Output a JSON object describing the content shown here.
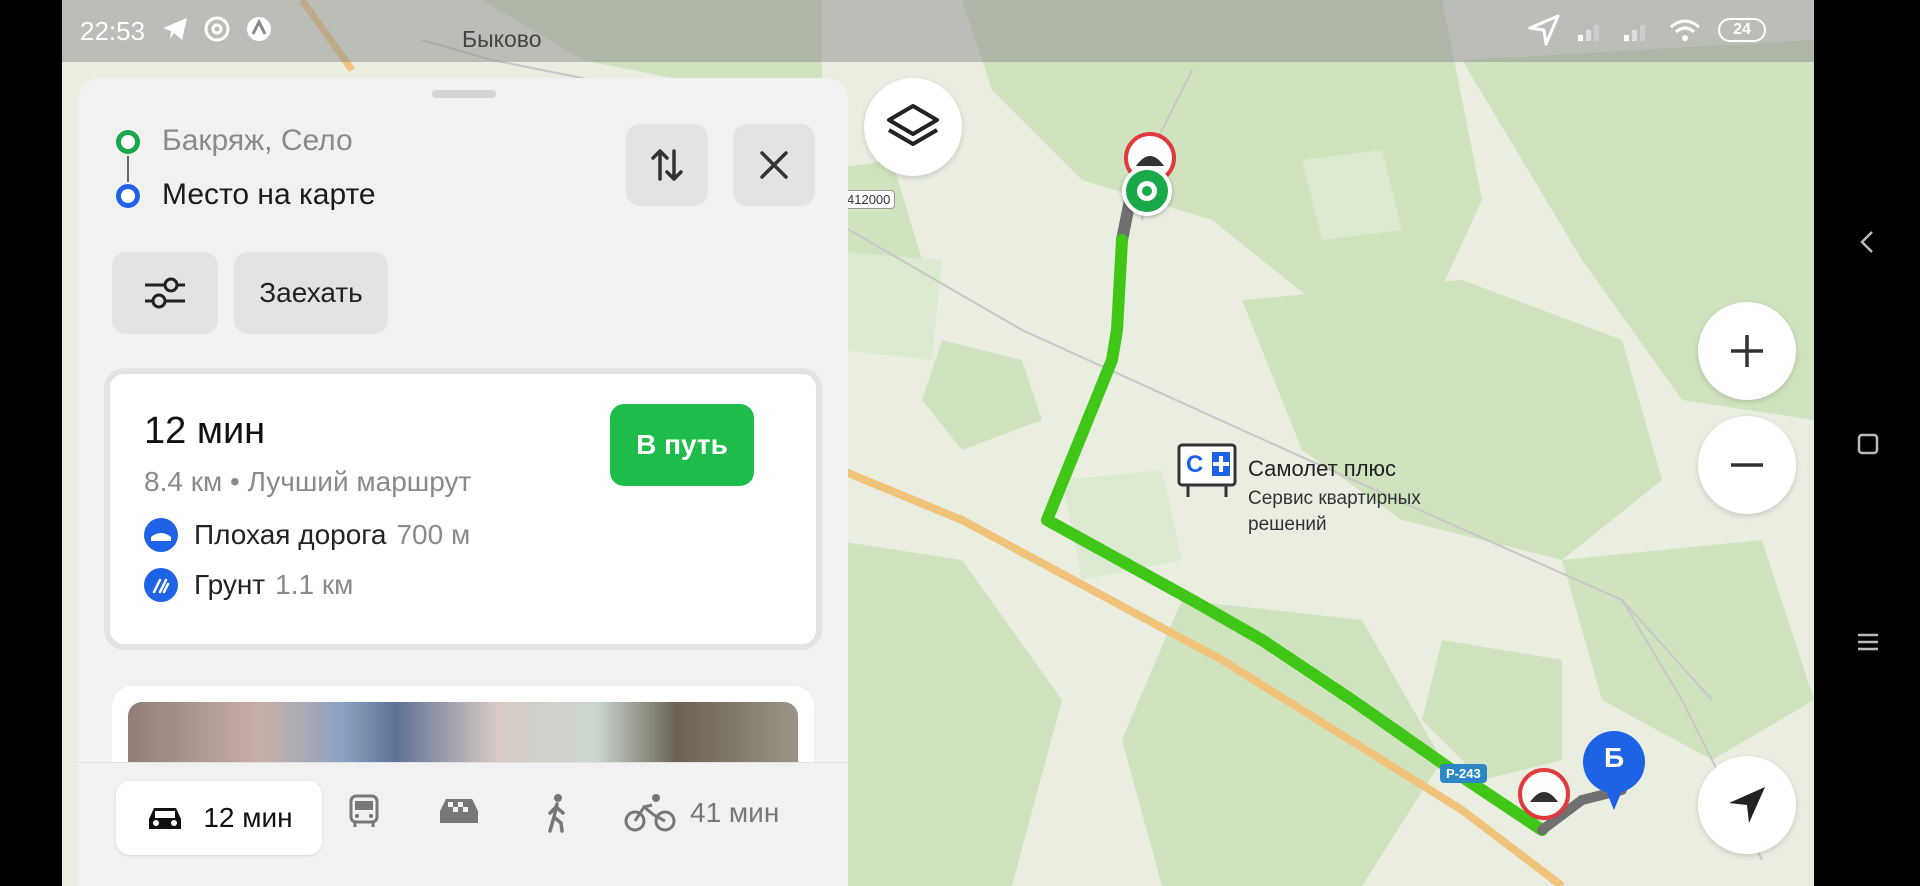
{
  "status_bar": {
    "time": "22:53",
    "battery": "24"
  },
  "map": {
    "city_label": "Быково",
    "road_code": "412000",
    "highway_badge": "Р-243",
    "poi": {
      "name": "Самолет плюс",
      "description": "Сервис квартирных решений",
      "logo_text": "С"
    },
    "destination_marker": "Б"
  },
  "route": {
    "from": "Бакряж, Село",
    "to": "Место на карте",
    "stop_button": "Заехать"
  },
  "route_card": {
    "duration": "12 мин",
    "summary": "8.4 км • Лучший маршрут",
    "go_button": "В путь",
    "warnings": [
      {
        "label": "Плохая дорога",
        "value": "700 м"
      },
      {
        "label": "Грунт",
        "value": "1.1 км"
      }
    ]
  },
  "transport_modes": {
    "car": "12 мин",
    "bike": "41 мин"
  },
  "colors": {
    "route": "#3fc617",
    "go_button": "#1ebc4b",
    "accent_blue": "#1e63e6"
  }
}
